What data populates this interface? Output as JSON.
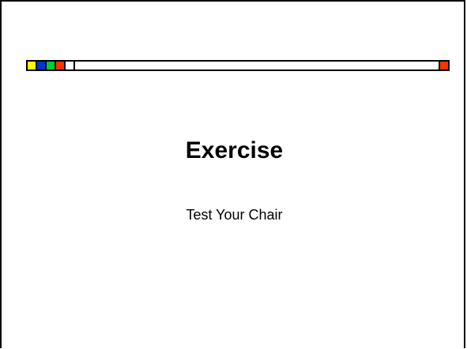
{
  "slide": {
    "title": "Exercise",
    "subtitle": "Test Your Chair"
  },
  "decor": {
    "squares": [
      {
        "name": "yellow-square",
        "color": "#ffff00"
      },
      {
        "name": "blue-square",
        "color": "#0033cc"
      },
      {
        "name": "green-square",
        "color": "#00cc33"
      },
      {
        "name": "red-square",
        "color": "#ff3300"
      },
      {
        "name": "white-square",
        "color": "#ffffff"
      }
    ],
    "end_square_color": "#ff3300",
    "border_color": "#000000",
    "background_color": "#ffffff"
  }
}
